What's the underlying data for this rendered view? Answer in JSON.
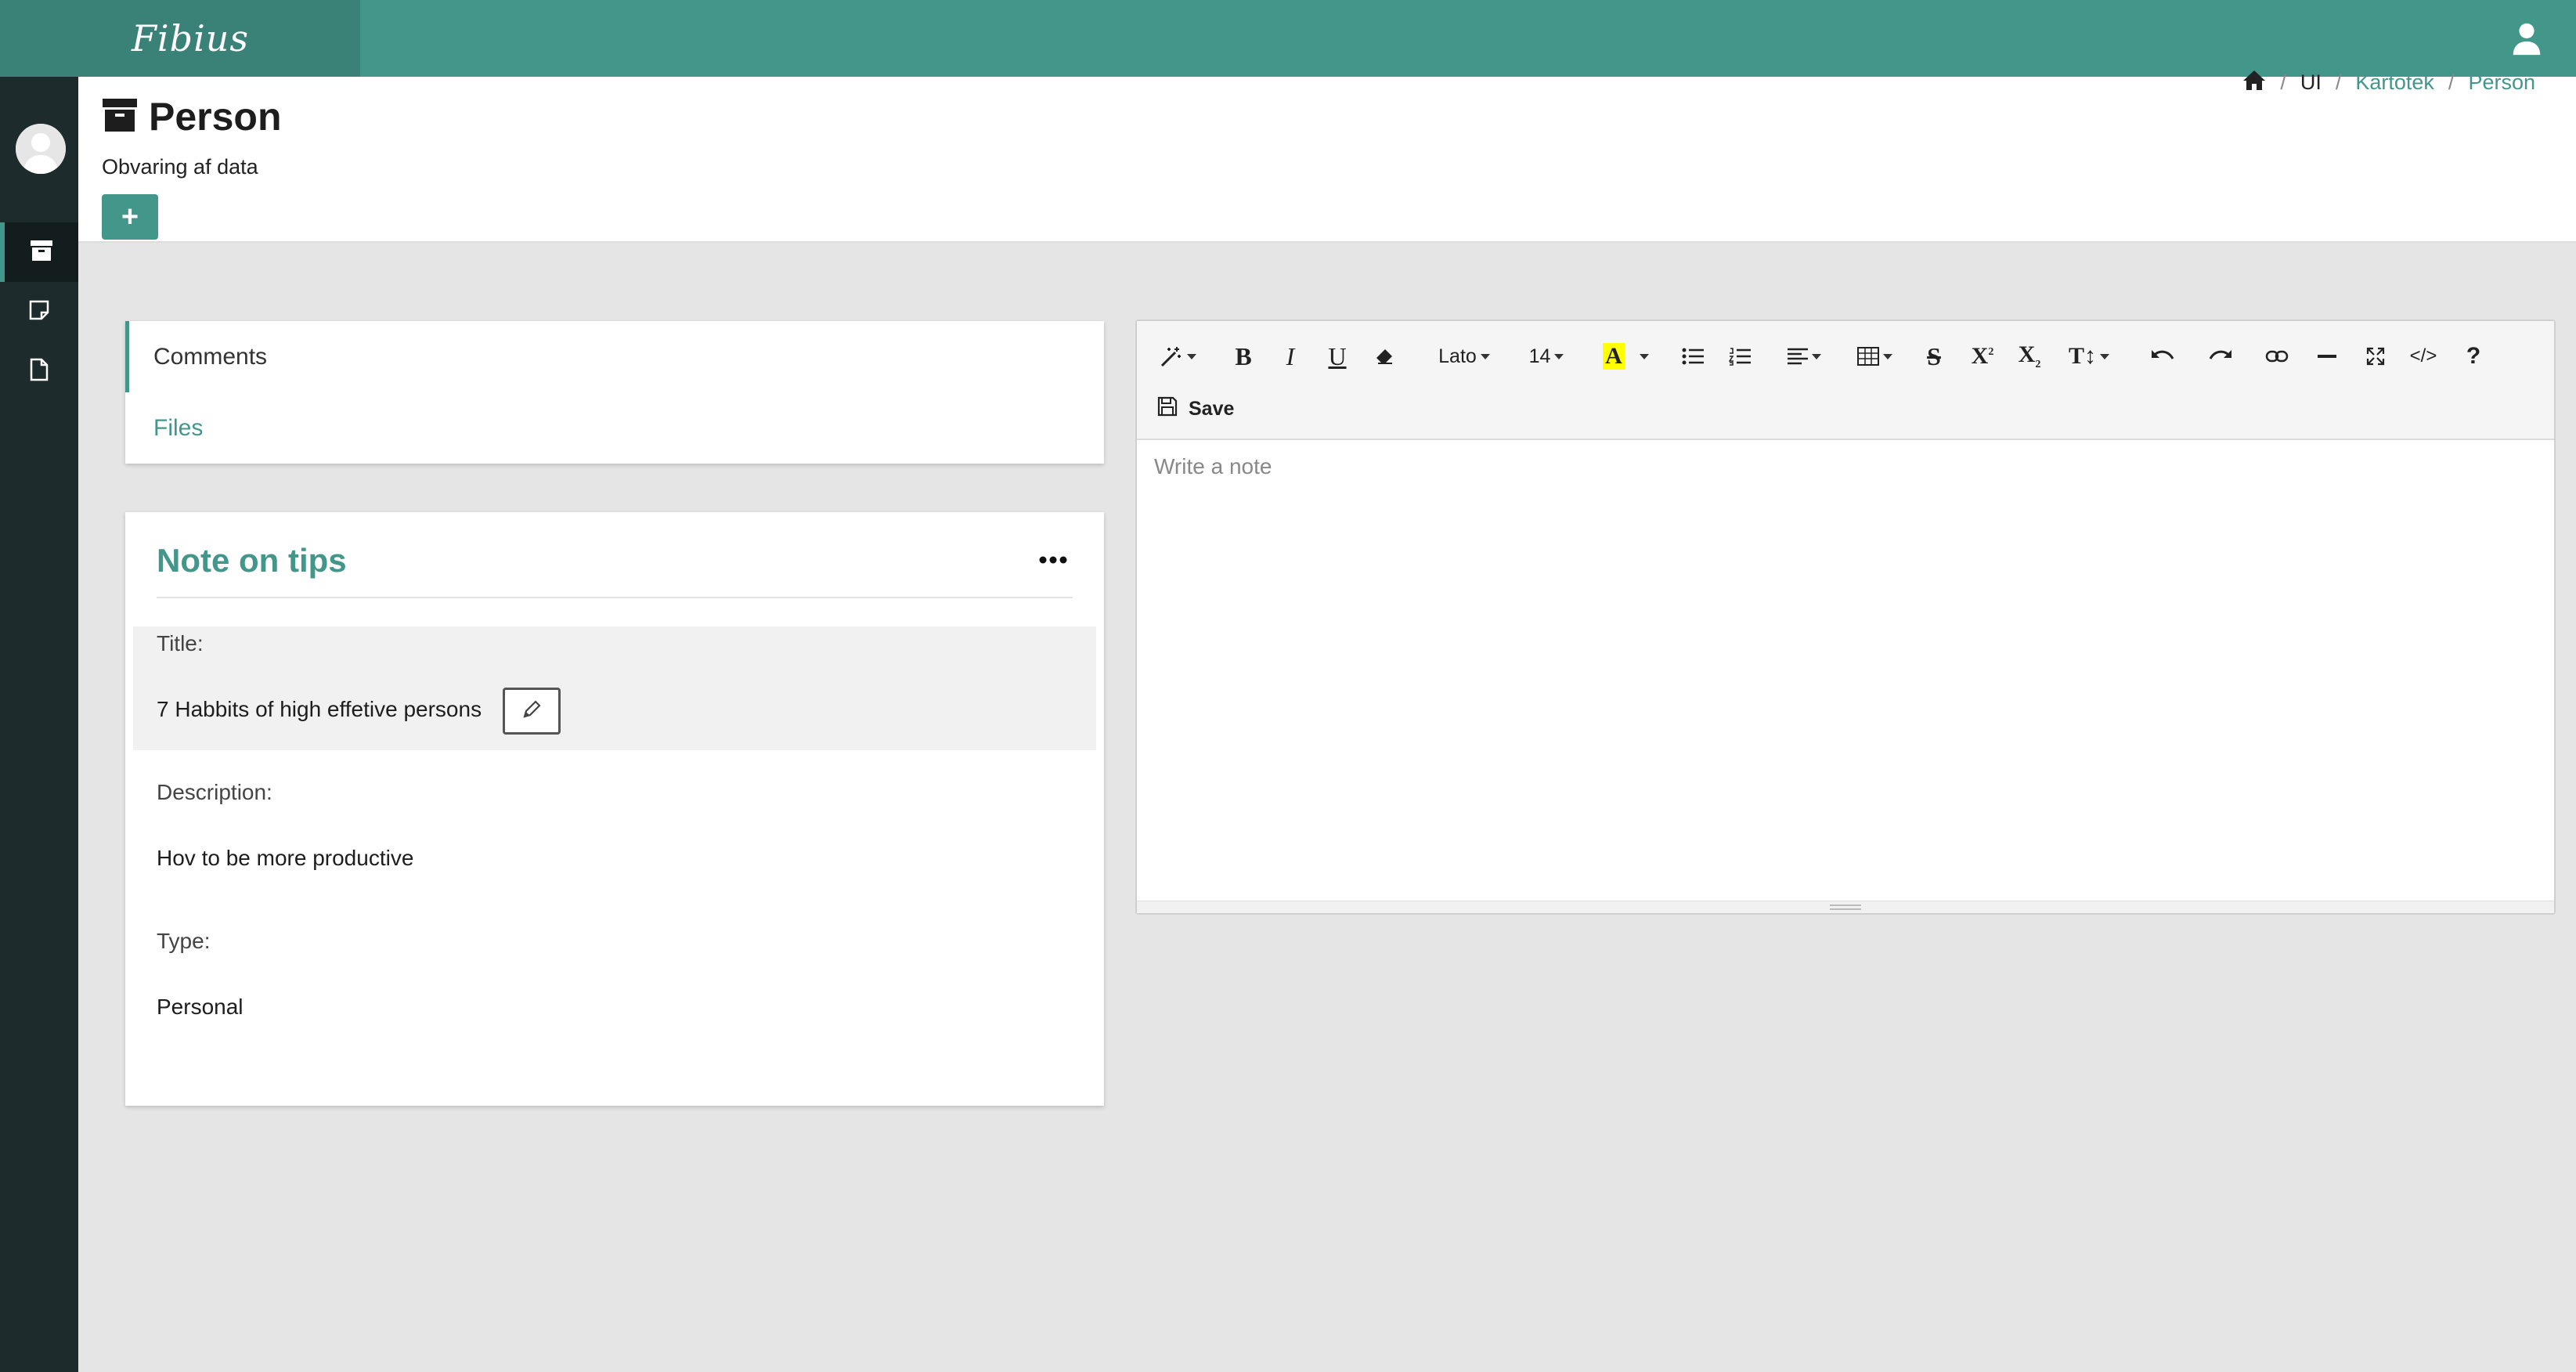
{
  "app": {
    "brand": "Fibius"
  },
  "page": {
    "title": "Person",
    "subtitle": "Obvaring af data",
    "add_label": "+"
  },
  "breadcrumb": {
    "items": [
      "UI",
      "Kartotek",
      "Person"
    ],
    "separator": "/"
  },
  "tabs": [
    {
      "label": "Comments"
    },
    {
      "label": "Files"
    }
  ],
  "note": {
    "heading": "Note on tips",
    "fields": [
      {
        "label": "Title:",
        "value": "7 Habbits of high effetive persons"
      },
      {
        "label": "Description:",
        "value": "Hov to be more productive"
      },
      {
        "label": "Type:",
        "value": "Personal"
      }
    ]
  },
  "editor": {
    "font_family": "Lato",
    "font_size": "14",
    "save_label": "Save",
    "placeholder": "Write a note"
  },
  "colors": {
    "accent": "#43968a",
    "brand_dark": "#3a8277",
    "sidebar": "#1e2b2d"
  }
}
